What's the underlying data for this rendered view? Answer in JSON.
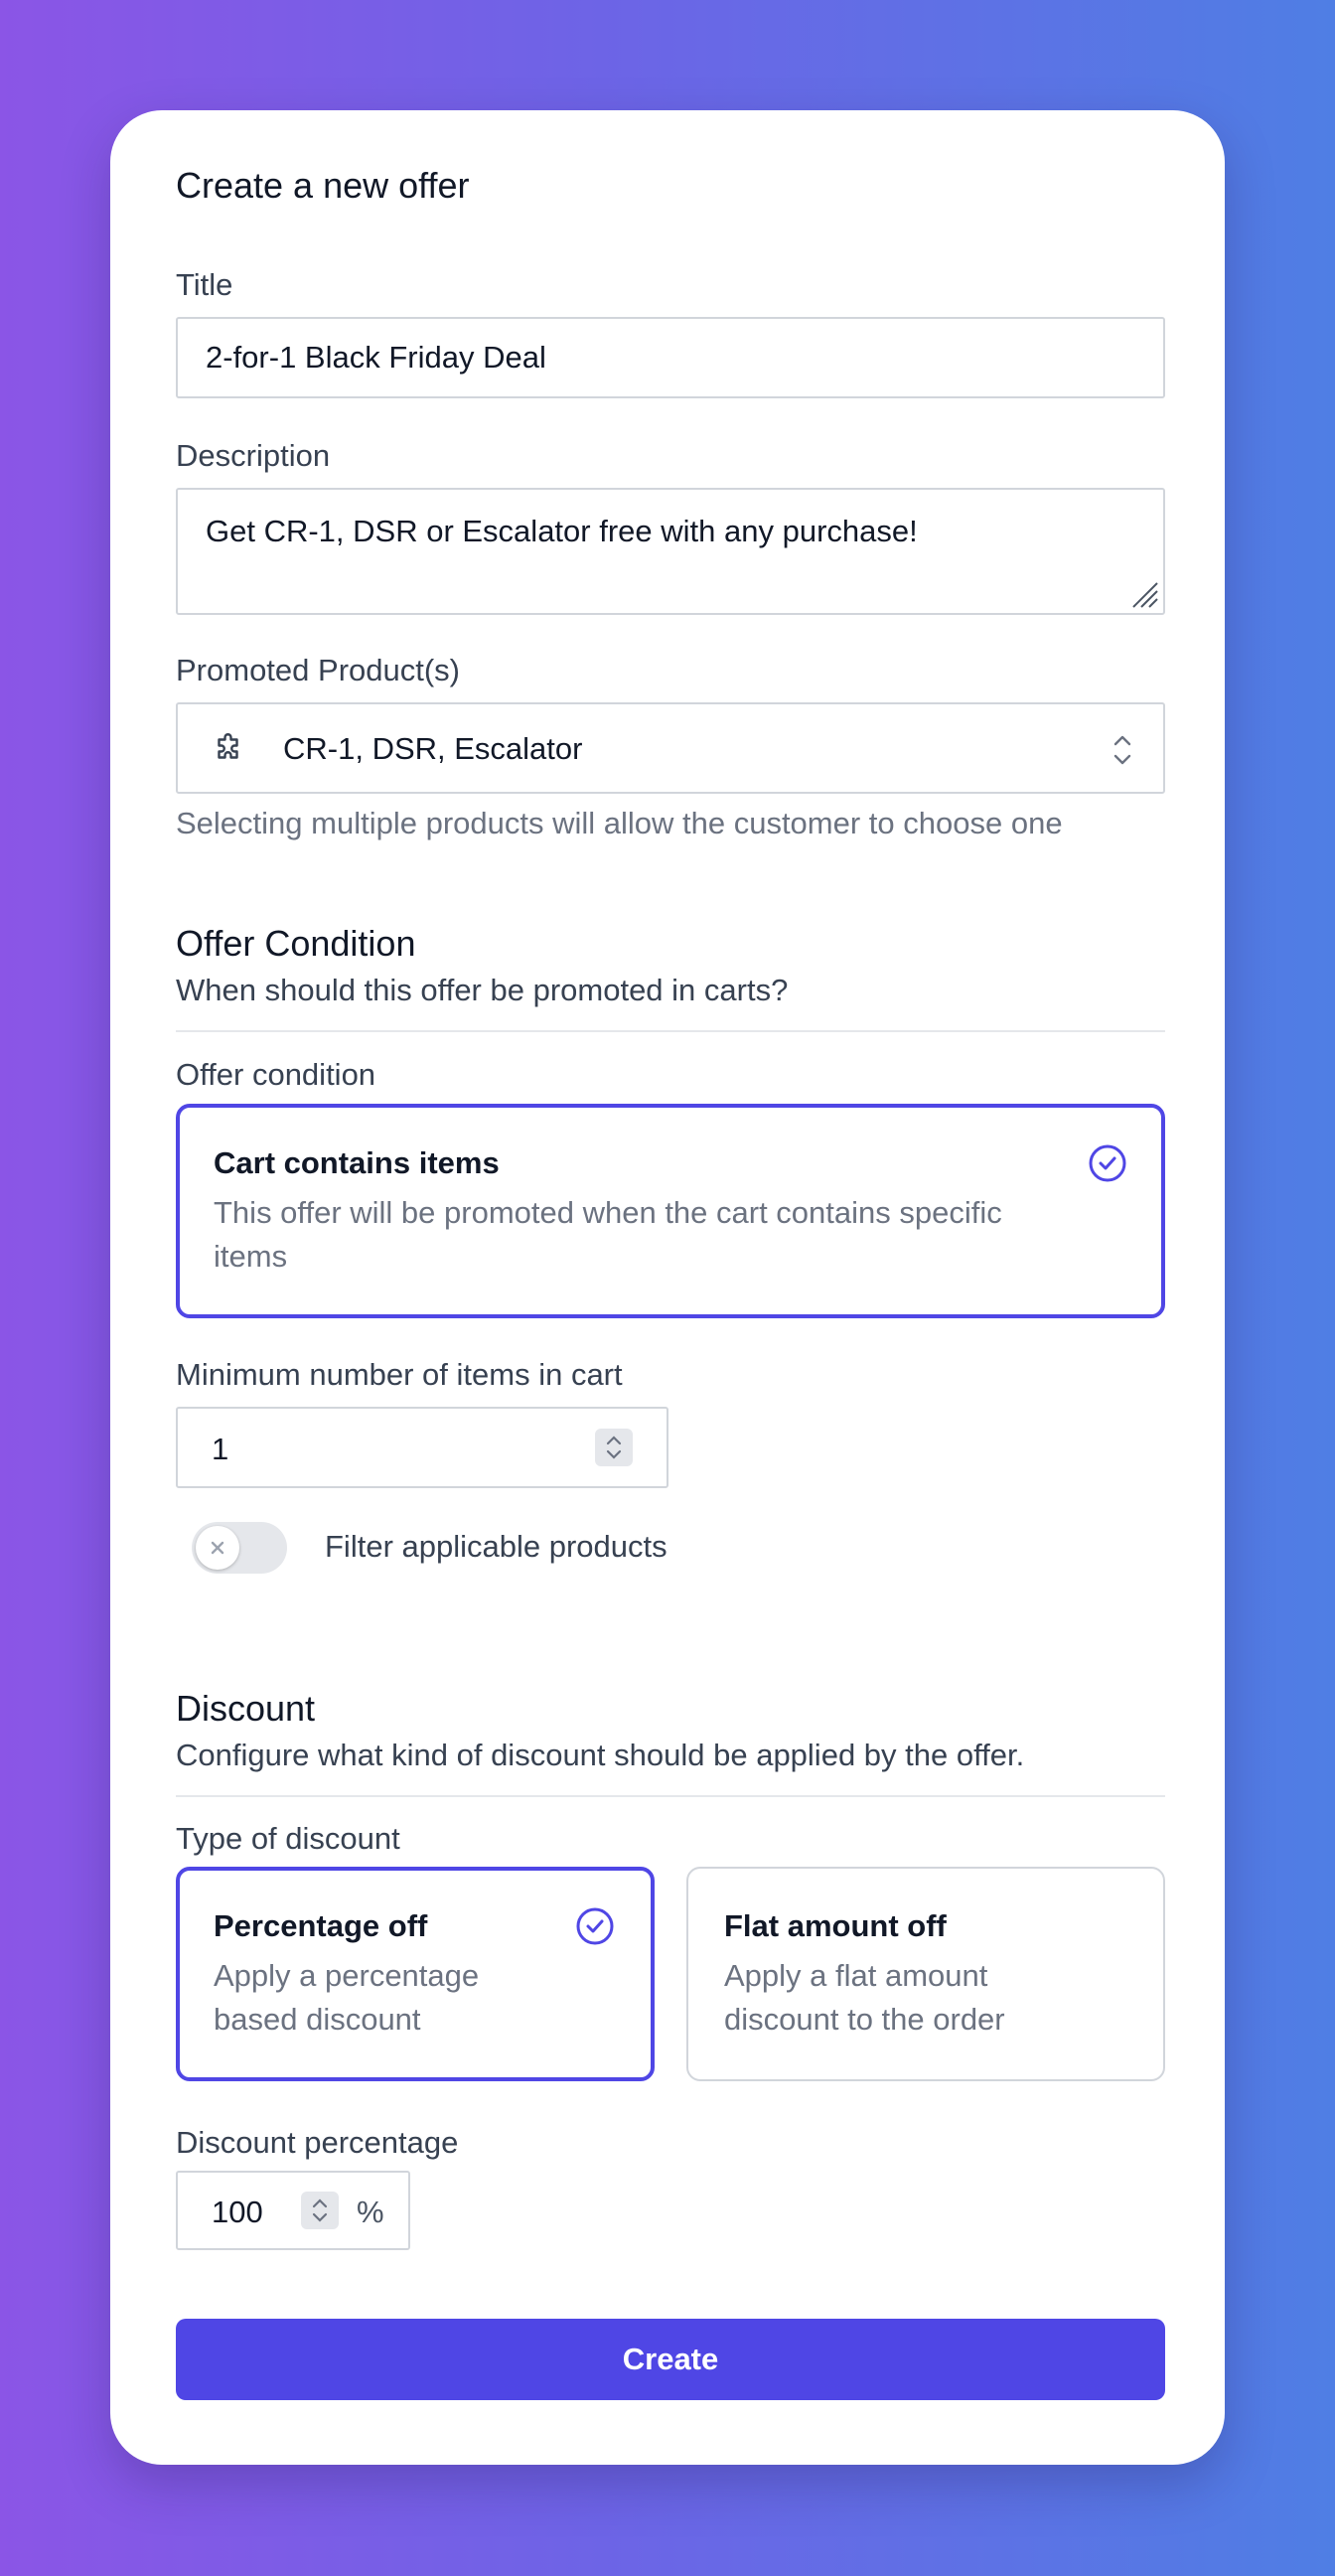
{
  "form": {
    "heading": "Create a new offer",
    "title_label": "Title",
    "title_value": "2-for-1 Black Friday Deal",
    "description_label": "Description",
    "description_value": "Get CR-1, DSR or Escalator free with any purchase!",
    "products_label": "Promoted Product(s)",
    "products_value": "CR-1, DSR, Escalator",
    "products_hint": "Selecting multiple products will allow the customer to choose one"
  },
  "condition": {
    "title": "Offer Condition",
    "subtitle": "When should this offer be promoted in carts?",
    "field_label": "Offer condition",
    "option_title": "Cart contains items",
    "option_desc_line1": "This offer will be promoted when the cart contains specific",
    "option_desc_line2": "items",
    "min_items_label": "Minimum number of items in cart",
    "min_items_value": "1",
    "filter_toggle_label": "Filter applicable products",
    "filter_toggle_on": false
  },
  "discount": {
    "title": "Discount",
    "subtitle": "Configure what kind of discount should be applied by the offer.",
    "type_label": "Type of discount",
    "options": [
      {
        "title": "Percentage off",
        "desc_line1": "Apply a percentage",
        "desc_line2": "based discount",
        "selected": true
      },
      {
        "title": "Flat amount off",
        "desc_line1": "Apply a flat amount",
        "desc_line2": "discount to the order",
        "selected": false
      }
    ],
    "percentage_label": "Discount percentage",
    "percentage_value": "100",
    "percent_suffix": "%"
  },
  "actions": {
    "create_label": "Create"
  },
  "icons": {
    "product": "puzzle-icon",
    "select_chevrons": "chevron-up-down-icon",
    "check": "check-circle-icon"
  },
  "colors": {
    "accent": "#4f46e5",
    "bg_gradient_start": "#8b55e6",
    "bg_gradient_end": "#4f7ee4"
  }
}
